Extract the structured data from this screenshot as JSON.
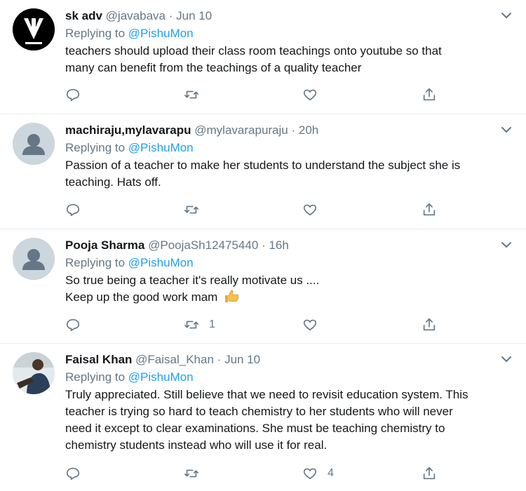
{
  "tweets": [
    {
      "name": "sk adv",
      "handle": "@javabava",
      "separator": "·",
      "time": "Jun 10",
      "replying_prefix": "Replying to ",
      "replying_to": "@PishuMon",
      "lines": [
        "teachers should upload their class room teachings onto youtube so that",
        "many can benefit from the teachings of a quality teacher"
      ],
      "retweets": "",
      "likes": ""
    },
    {
      "name": "machiraju,mylavarapu",
      "handle": "@mylavarapuraju",
      "separator": "·",
      "time": "20h",
      "replying_prefix": "Replying to ",
      "replying_to": "@PishuMon",
      "lines": [
        "Passion of a teacher to make her students to understand the subject she is",
        "teaching. Hats off."
      ],
      "retweets": "",
      "likes": ""
    },
    {
      "name": "Pooja Sharma",
      "handle": "@PoojaSh12475440",
      "separator": "·",
      "time": "16h",
      "replying_prefix": "Replying to ",
      "replying_to": "@PishuMon",
      "lines": [
        "So true being a teacher it's really motivate us ....",
        "Keep up the good work mam"
      ],
      "emoji": "thumbs-up-emoji",
      "retweets": "1",
      "likes": ""
    },
    {
      "name": "Faisal Khan",
      "handle": "@Faisal_Khan",
      "separator": "·",
      "time": "Jun 10",
      "replying_prefix": "Replying to ",
      "replying_to": "@PishuMon",
      "lines": [
        "Truly appreciated. Still believe that we need to revisit education system. This",
        "teacher is trying so hard to teach chemistry to her students who will never",
        "need it except to clear examinations. She must be teaching chemistry to",
        "chemistry students instead who will use it for real."
      ],
      "retweets": "",
      "likes": "4"
    }
  ],
  "icons": {
    "reply": "reply-icon",
    "retweet": "retweet-icon",
    "like": "heart-icon",
    "share": "share-icon",
    "more": "chevron-down-icon"
  },
  "colors": {
    "accent": "#1da1f2",
    "secondary_text": "#657786",
    "divider": "#e6ecf0"
  }
}
